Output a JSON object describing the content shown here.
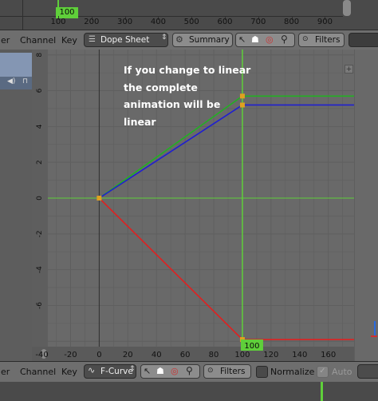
{
  "top_ruler": {
    "ticks": [
      "100",
      "200",
      "300",
      "400",
      "500",
      "600",
      "700",
      "800",
      "900"
    ],
    "frame_indicator": "100"
  },
  "dope_sheet_header": {
    "view_menu_partial": "er",
    "channel_menu": "Channel",
    "key_menu": "Key",
    "mode_select": "Dope Sheet",
    "summary_button": "Summary",
    "filters_button": "Filters"
  },
  "graph": {
    "annotation": "If you change to linear the complete animation will be linear",
    "y_ticks": [
      "8",
      "6",
      "4",
      "2",
      "0",
      "-2",
      "-4",
      "-6"
    ],
    "x_ticks": [
      "-40",
      "-20",
      "0",
      "20",
      "40",
      "60",
      "80",
      "100",
      "120",
      "140",
      "160"
    ],
    "current_frame": "100",
    "colors": {
      "x_curve": "#e02020",
      "y_curve": "#22b022",
      "z_curve": "#2020d0",
      "cursor": "#5fcf3a",
      "keyframe": "#e0a020"
    }
  },
  "chart_data": {
    "type": "line",
    "xlim": [
      -47,
      178
    ],
    "ylim": [
      -8.3,
      8.3
    ],
    "series": [
      {
        "color": "#22b022",
        "x": [
          0,
          100,
          178
        ],
        "y": [
          0,
          5.7,
          5.7
        ]
      },
      {
        "color": "#2020d0",
        "x": [
          0,
          100,
          178
        ],
        "y": [
          0,
          5.2,
          5.2
        ]
      },
      {
        "color": "#e02020",
        "x": [
          0,
          100,
          178
        ],
        "y": [
          0,
          -7.9,
          -7.9
        ]
      }
    ],
    "keyframes": [
      {
        "x": 0,
        "y": 0
      },
      {
        "x": 100,
        "y": 5.7
      },
      {
        "x": 100,
        "y": 5.2
      },
      {
        "x": 100,
        "y": -7.9
      }
    ],
    "grid": true
  },
  "fcurve_header": {
    "view_menu_partial": "er",
    "channel_menu": "Channel",
    "key_menu": "Key",
    "mode_select": "F-Curve",
    "filters_button": "Filters",
    "normalize_label": "Normalize",
    "auto_label": "Auto"
  }
}
